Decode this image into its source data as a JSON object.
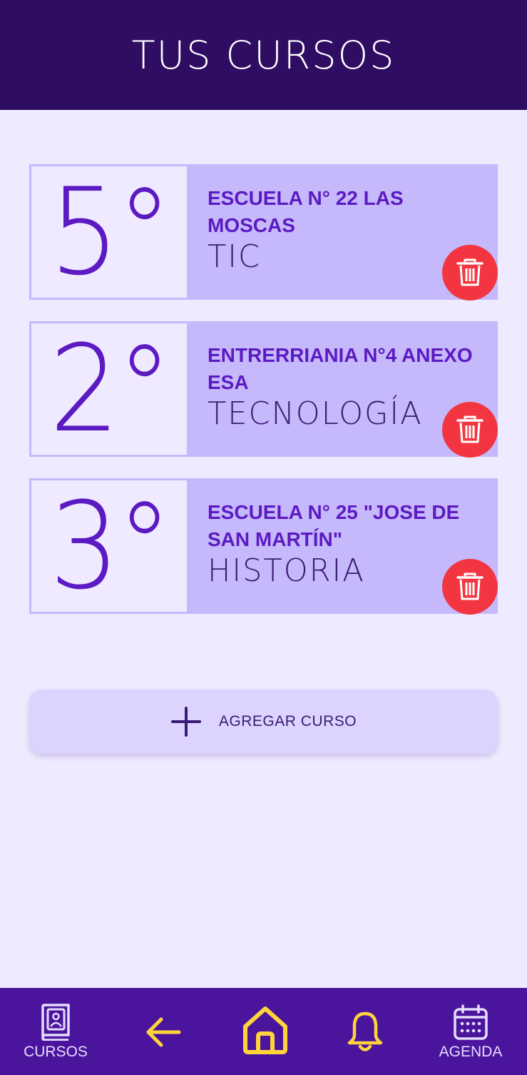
{
  "header": {
    "title": "TUS CURSOS"
  },
  "courses": [
    {
      "grade": "5°",
      "school": "ESCUELA N° 22 LAS MOSCAS",
      "subject": "TIC"
    },
    {
      "grade": "2°",
      "school": "ENTRERRIANIA N°4 ANEXO ESA",
      "subject": "TECNOLOGÍA"
    },
    {
      "grade": "3°",
      "school": "ESCUELA N° 25 \"JOSE DE SAN MARTÍN\"",
      "subject": "HISTORIA"
    }
  ],
  "add_course": {
    "label": "AGREGAR CURSO",
    "icon": "plus-icon"
  },
  "nav": {
    "cursos": {
      "label": "CURSOS",
      "icon": "book-icon"
    },
    "back": {
      "icon": "arrow-left-icon"
    },
    "home": {
      "icon": "home-icon"
    },
    "notifications": {
      "icon": "bell-icon"
    },
    "agenda": {
      "label": "AGENDA",
      "icon": "calendar-icon"
    }
  },
  "colors": {
    "header_bg": "#2e0d63",
    "page_bg": "#eeeaff",
    "card_bg": "#c5b8fb",
    "accent": "#5c1ac2",
    "delete": "#f23540",
    "nav_bg": "#4a159c",
    "nav_accent": "#ffd43b"
  }
}
